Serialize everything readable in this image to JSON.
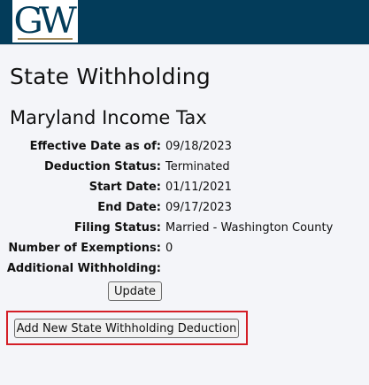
{
  "header": {
    "logo_text": "GW"
  },
  "page": {
    "title": "State Withholding"
  },
  "section": {
    "title": "Maryland Income Tax",
    "details": [
      {
        "label": "Effective Date as of:",
        "value": "09/18/2023"
      },
      {
        "label": "Deduction Status:",
        "value": "Terminated"
      },
      {
        "label": "Start Date:",
        "value": "01/11/2021"
      },
      {
        "label": "End Date:",
        "value": "09/17/2023"
      },
      {
        "label": "Filing Status:",
        "value": "Married - Washington County"
      },
      {
        "label": "Number of Exemptions:",
        "value": "0"
      },
      {
        "label": "Additional Withholding:",
        "value": ""
      }
    ]
  },
  "buttons": {
    "update_label": "Update",
    "add_new_label": "Add New State Withholding Deduction"
  },
  "colors": {
    "header_bg": "#033c5a",
    "highlight_border": "#d41e27"
  }
}
